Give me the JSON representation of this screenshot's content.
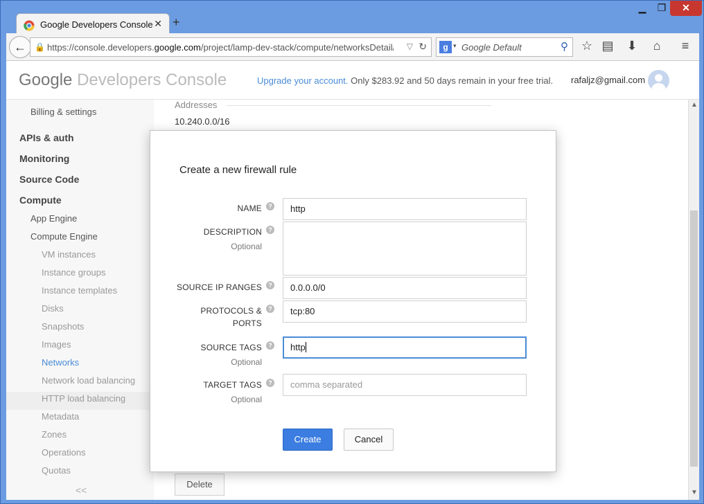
{
  "browser": {
    "tab_title": "Google Developers Console",
    "url_prefix": "https://console.developers.",
    "url_domain": "google.com",
    "url_rest": "/project/lamp-dev-stack/compute/networksDetail/global/",
    "search_placeholder": "Google Default"
  },
  "header": {
    "logo_google": "Google",
    "logo_product": "Developers Console",
    "upgrade_link": "Upgrade your account.",
    "upgrade_text": "Only $283.92 and 50 days remain in your free trial.",
    "email": "rafaljz@gmail.com"
  },
  "sidebar": {
    "billing": "Billing & settings",
    "apis": "APIs & auth",
    "monitoring": "Monitoring",
    "source": "Source Code",
    "compute": "Compute",
    "app_engine": "App Engine",
    "compute_engine": "Compute Engine",
    "items": [
      "VM instances",
      "Instance groups",
      "Instance templates",
      "Disks",
      "Snapshots",
      "Images",
      "Networks",
      "Network load balancing",
      "HTTP load balancing",
      "Metadata",
      "Zones",
      "Operations",
      "Quotas"
    ],
    "collapse": "<<"
  },
  "main": {
    "addresses_label": "Addresses",
    "addresses_value": "10.240.0.0/16",
    "delete_button": "Delete"
  },
  "dialog": {
    "title": "Create a new firewall rule",
    "optional": "Optional",
    "name_label": "NAME",
    "name_value": "http",
    "description_label": "DESCRIPTION",
    "description_value": "",
    "source_ip_label": "SOURCE IP RANGES",
    "source_ip_value": "0.0.0.0/0",
    "protocols_label_1": "PROTOCOLS &",
    "protocols_label_2": "PORTS",
    "protocols_value": "tcp:80",
    "source_tags_label": "SOURCE TAGS",
    "source_tags_value": "http",
    "target_tags_label": "TARGET TAGS",
    "target_tags_placeholder": "comma separated",
    "create_button": "Create",
    "cancel_button": "Cancel"
  }
}
